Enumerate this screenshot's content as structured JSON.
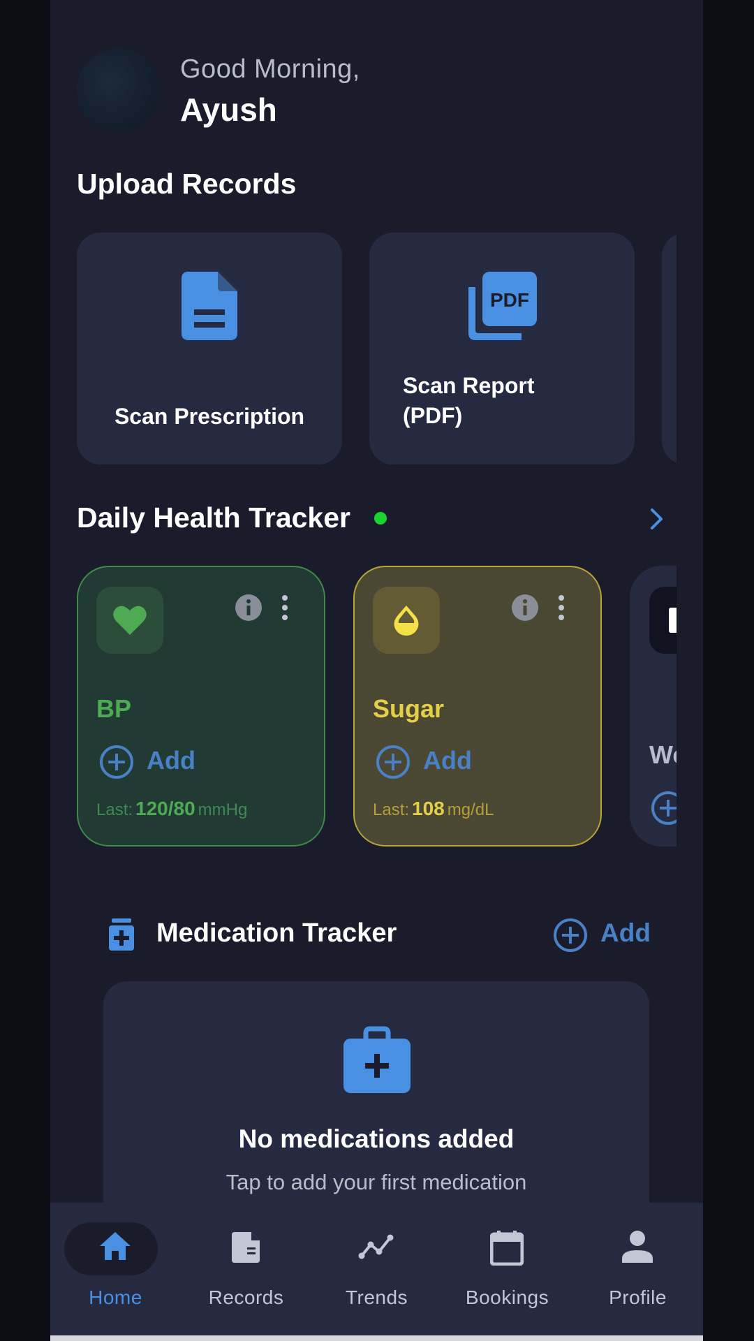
{
  "greeting": {
    "line": "Good Morning,",
    "name": "Ayush"
  },
  "upload": {
    "title": "Upload Records",
    "cards": [
      {
        "label": "Scan Prescription",
        "icon": "document-icon"
      },
      {
        "label_line1": "Scan Report",
        "label_line2": "(PDF)",
        "icon": "pdf-icon"
      }
    ]
  },
  "tracker": {
    "title": "Daily Health Tracker",
    "status_color": "#19d330",
    "cards": [
      {
        "name": "BP",
        "icon": "heart-icon",
        "add_label": "Add",
        "last_label": "Last:",
        "last_value": "120/80",
        "unit": "mmHg",
        "accent": "#4eab53"
      },
      {
        "name": "Sugar",
        "icon": "drop-icon",
        "add_label": "Add",
        "last_label": "Last:",
        "last_value": "108",
        "unit": "mg/dL",
        "accent": "#e3cf48"
      },
      {
        "name_partial": "We",
        "icon": "scale-icon"
      }
    ]
  },
  "medication": {
    "title": "Medication Tracker",
    "add_label": "Add",
    "empty_title": "No medications added",
    "empty_subtitle": "Tap to add your first medication"
  },
  "nav": {
    "items": [
      {
        "label": "Home",
        "icon": "home-icon",
        "active": true
      },
      {
        "label": "Records",
        "icon": "records-icon"
      },
      {
        "label": "Trends",
        "icon": "trends-icon"
      },
      {
        "label": "Bookings",
        "icon": "calendar-icon"
      },
      {
        "label": "Profile",
        "icon": "person-icon"
      }
    ]
  },
  "colors": {
    "accent": "#4a90e2",
    "background": "#1a1c2b",
    "card": "#262a41"
  }
}
